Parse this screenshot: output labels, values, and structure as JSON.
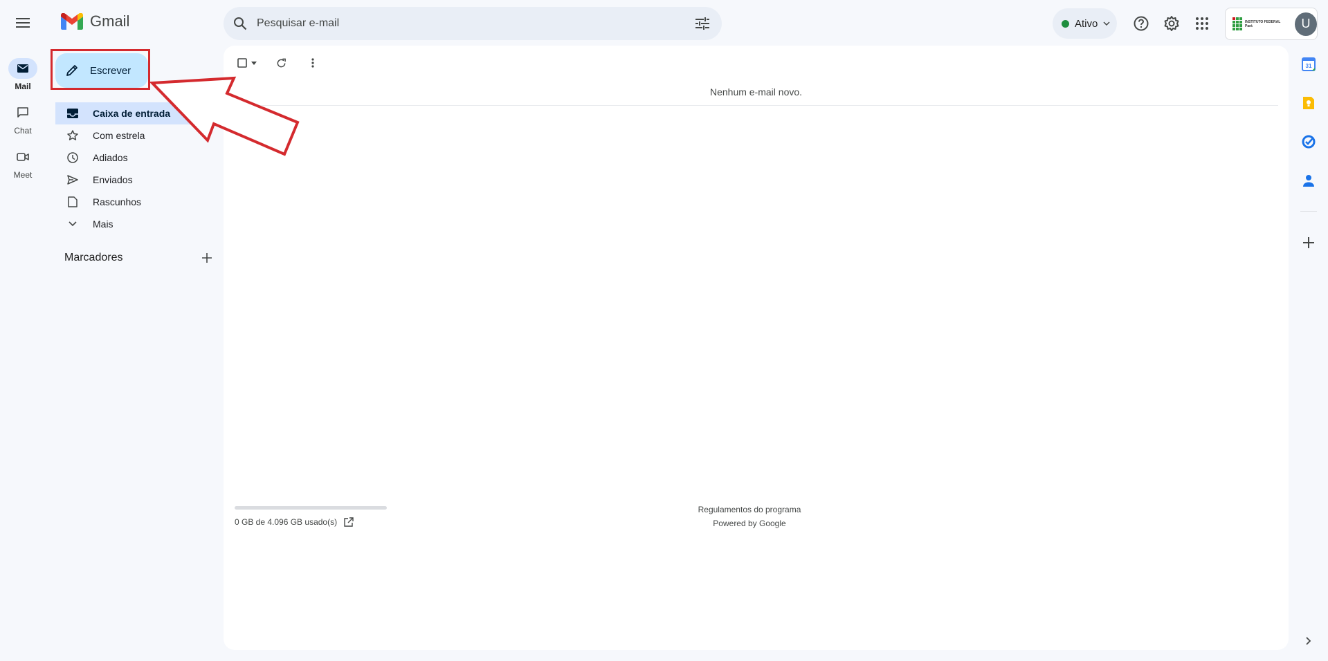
{
  "app": {
    "name": "Gmail"
  },
  "search": {
    "placeholder": "Pesquisar e-mail"
  },
  "status": {
    "label": "Ativo"
  },
  "account": {
    "org_line1": "INSTITUTO FEDERAL",
    "org_line2": "Pará",
    "avatar_letter": "U"
  },
  "rail": [
    {
      "label": "Mail",
      "icon": "mail-icon",
      "active": true
    },
    {
      "label": "Chat",
      "icon": "chat-icon",
      "active": false
    },
    {
      "label": "Meet",
      "icon": "meet-icon",
      "active": false
    }
  ],
  "compose": {
    "label": "Escrever"
  },
  "nav": [
    {
      "label": "Caixa de entrada",
      "icon": "inbox-icon",
      "active": true
    },
    {
      "label": "Com estrela",
      "icon": "star-icon"
    },
    {
      "label": "Adiados",
      "icon": "clock-icon"
    },
    {
      "label": "Enviados",
      "icon": "send-icon"
    },
    {
      "label": "Rascunhos",
      "icon": "draft-icon"
    },
    {
      "label": "Mais",
      "icon": "chevron-down-icon"
    }
  ],
  "labels": {
    "title": "Marcadores"
  },
  "main": {
    "empty_message": "Nenhum e-mail novo."
  },
  "storage": {
    "text": "0 GB de 4.096 GB usado(s)",
    "used_fraction": 0.0
  },
  "footer": {
    "program_policies": "Regulamentos do programa",
    "powered_by": "Powered by Google"
  },
  "colors": {
    "accent": "#0b57d0",
    "compose_bg": "#c2e7ff",
    "active_nav": "#d3e3fd",
    "annotation_red": "#d42a2e",
    "status_green": "#1e8e3e"
  }
}
